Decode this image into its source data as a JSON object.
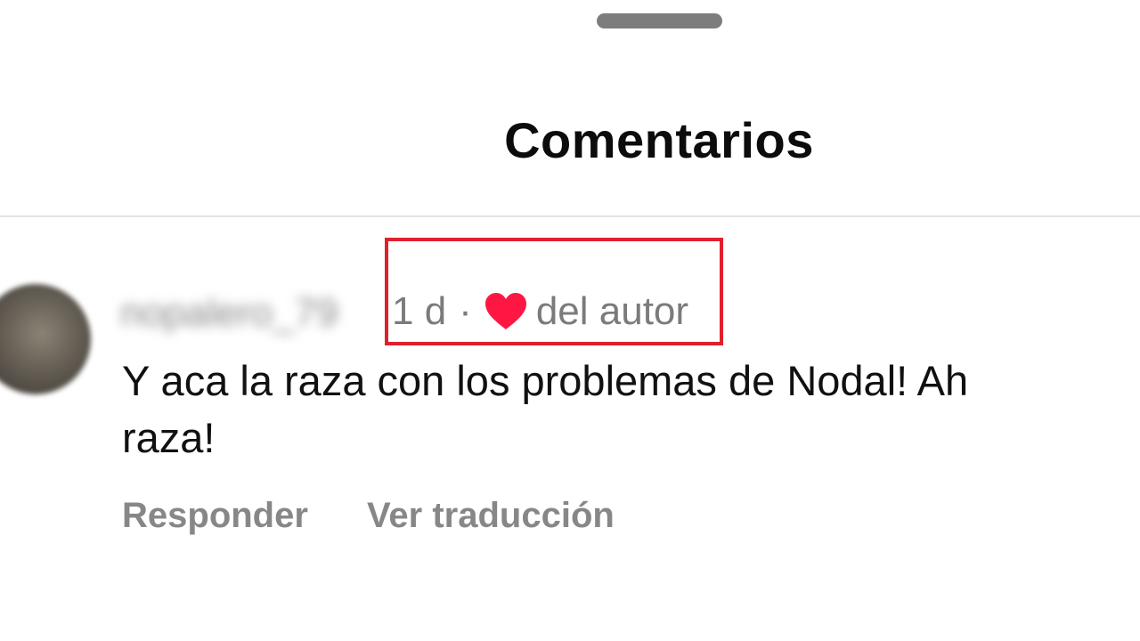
{
  "sheet": {
    "title": "Comentarios"
  },
  "comment": {
    "username": "nopalero_79",
    "time": "1 d",
    "separator": "·",
    "liked_by_label": "del autor",
    "heart_icon": "heart-icon",
    "heart_color": "#ff1744",
    "text": "Y aca la raza con los problemas de Nodal! Ah\nraza!",
    "actions": {
      "reply_label": "Responder",
      "translate_label": "Ver traducción"
    }
  },
  "highlight": {
    "color": "#e0202e"
  }
}
